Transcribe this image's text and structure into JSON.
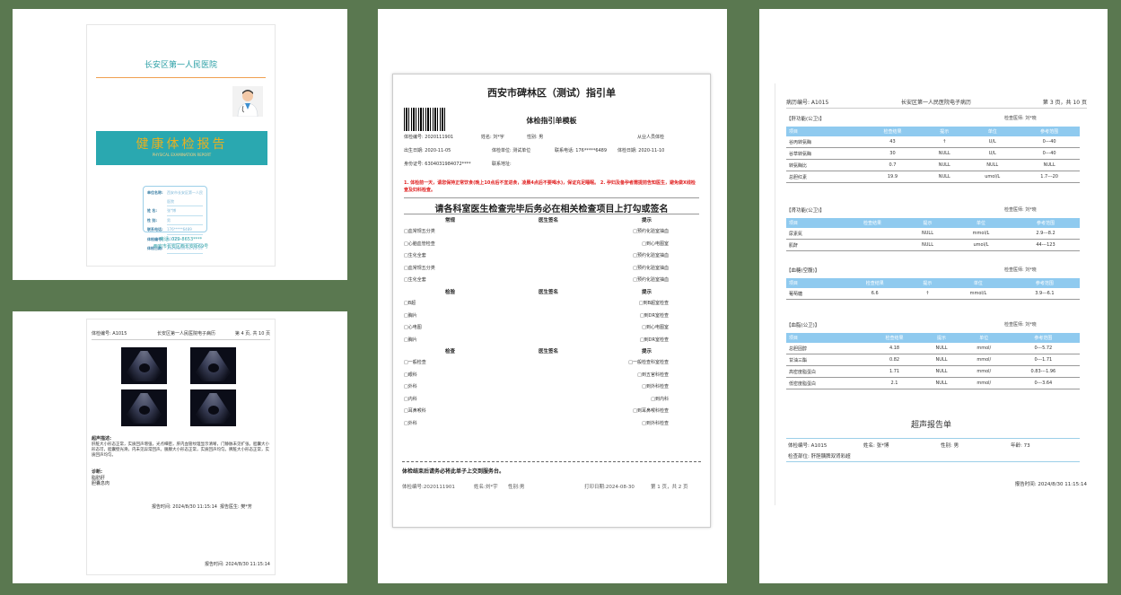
{
  "cover": {
    "hospital": "长安区第一人民医院",
    "title": "健康体检报告",
    "subtitle": "PHYSICAL EXAMINATION REPORT",
    "fields": [
      {
        "label": "单位名称:",
        "value": "西安市长安区第一人民医院"
      },
      {
        "label": "姓    名:",
        "value": "张*博"
      },
      {
        "label": "性    别:",
        "value": "男"
      },
      {
        "label": "联系电话:",
        "value": "176*****6489"
      },
      {
        "label": "体检编号:",
        "value": "A1015"
      },
      {
        "label": "体检日期:",
        "value": "2024/8/30 11:15:14"
      }
    ],
    "phone": "电话: 029-8653****",
    "address": "西安市长安区西长安街69号"
  },
  "ultrasound_page": {
    "header_left": "体检编号: A1015",
    "header_center": "长安区第一人民医院电子病历",
    "header_right": "第 4 页, 共 10 页",
    "findings_title": "超声描述:",
    "findings_text": "肝脏大小形态正常，实质回声增强，光点细密，肝内血管纹理显示清晰，门静脉未见扩张。胆囊大小形态可，胆囊壁光滑，内未见异常回声。",
    "findings_text2": "胰腺大小形态正常，实质回声均匀。脾脏大小形态正常，实质回声均匀。",
    "diagnosis_title": "诊断:",
    "diagnosis": [
      "脂肪肝",
      "胆囊息肉"
    ],
    "report_time": "报告时间: 2024/8/30 11:15:14",
    "doctor": "报告医生: 樊*芳",
    "print_time": "报告时间: 2024/8/30 11:15:14"
  },
  "guide": {
    "title": "西安市碑林区（测试）指引单",
    "subtitle": "体检指引单模板",
    "info": [
      [
        "体检编号: 2020111901",
        "姓名: 刘*宇",
        "性别: 男",
        "从业人员体检"
      ],
      [
        "出生日期: 2020-11-05",
        "体检单位: 测试单位",
        "联系电话: 176*****6489",
        "体检日期: 2020-11-10"
      ],
      [
        "身份证号: 6304031984072****",
        "联系地址:"
      ]
    ],
    "warning": "1. 体检前一天，请您保持正常饮食(晚上10点后不宜进食，凌晨4点后不要喝水)，保证充足睡眠。 2. 孕妇及备孕者需提前告知医生，避免做X线检查及妇科检查。",
    "instruction": "请各科室医生检查完毕后务必在相关检查项目上打勾或签名",
    "col_item": "常规",
    "col_sign": "医生签名",
    "col_tip": "提示",
    "group1": [
      [
        "□血常规五分类",
        "□预约化验室抽血"
      ],
      [
        "□心脑血管检查",
        "□到心电图室"
      ],
      [
        "□生化全套",
        "□预约化验室抽血"
      ],
      [
        "□血常规五分类",
        "□预约化验室抽血"
      ],
      [
        "□生化全套",
        "□预约化验室抽血"
      ]
    ],
    "col_item2": "检验",
    "group2": [
      [
        "□B超",
        "□到B超室检查"
      ],
      [
        "□胸片",
        "□到DR室检查"
      ],
      [
        "□心电图",
        "□到心电图室"
      ],
      [
        "□胸片",
        "□到DR室检查"
      ]
    ],
    "col_item3": "检查",
    "group3": [
      [
        "□一般检查",
        "□一般检查科室检查"
      ],
      [
        "□眼科",
        "□到五官科检查"
      ],
      [
        "□外科",
        "□到外科检查"
      ],
      [
        "□内科",
        "□到内科"
      ],
      [
        "□耳鼻喉科",
        "□到耳鼻喉科检查"
      ],
      [
        "□外科",
        "□到外科检查"
      ]
    ],
    "end_note": "体检结束后请务必将此单子上交到服务台。",
    "foot_id": "体检编号:2020111901",
    "foot_name": "姓名:刘*宇",
    "foot_gender": "性别:男",
    "foot_print": "打印日期:2024-08-30",
    "foot_page": "第 1 页，共 2 页"
  },
  "lab": {
    "header_left": "病历编号: A1015",
    "header_center": "长安区第一人民医院电子病历",
    "header_right": "第 3 页，共 10 页",
    "columns": [
      "项目",
      "检查结果",
      "提示",
      "单位",
      "参考范围"
    ],
    "sections": [
      {
        "title": "【肝功能(公卫)】",
        "doctor": "检查医师: 刘*晓",
        "rows": [
          [
            "谷丙转氨酶",
            "43",
            "↑",
            "U/L",
            "0---40"
          ],
          [
            "谷草转氨酶",
            "30",
            "NULL",
            "U/L",
            "0---40"
          ],
          [
            "转氨酶比",
            "0.7",
            "NULL",
            "NULL",
            "NULL"
          ],
          [
            "总胆红素",
            "19.9",
            "NULL",
            "umol/L",
            "1.7---20"
          ]
        ]
      },
      {
        "title": "【肾功能(公卫)】",
        "doctor": "检查医师: 刘*晓",
        "rows": [
          [
            "尿素氮",
            "",
            "NULL",
            "mmol/L",
            "2.9---8.2"
          ],
          [
            "肌酐",
            "",
            "NULL",
            "umol/L",
            "44---123"
          ]
        ]
      },
      {
        "title": "【血糖(空腹)】",
        "doctor": "检查医师: 刘*晓",
        "rows": [
          [
            "葡萄糖",
            "6.6",
            "↑",
            "mmol/L",
            "3.9---6.1"
          ]
        ]
      },
      {
        "title": "【血脂(公卫)】",
        "doctor": "检查医师: 刘*晓",
        "rows": [
          [
            "总胆固醇",
            "4.18",
            "NULL",
            "mmol/",
            "0---5.72"
          ],
          [
            "甘油三酯",
            "0.82",
            "NULL",
            "mmol/",
            "0---1.71"
          ],
          [
            "高密度脂蛋白",
            "1.71",
            "NULL",
            "mmol/",
            "0.83---1.96"
          ],
          [
            "低密度脂蛋白",
            "2.1",
            "NULL",
            "mmol/",
            "0---3.64"
          ]
        ]
      }
    ],
    "us_title": "超声报告单",
    "us_id": "体检编号: A1015",
    "us_name": "姓名: 张*博",
    "us_gender": "性别: 男",
    "us_age": "年龄: 73",
    "us_part": "检查部位: 肝胆胰脾双肾彩超",
    "report_time": "报告时间: 2024/8/30 11:15:14"
  }
}
